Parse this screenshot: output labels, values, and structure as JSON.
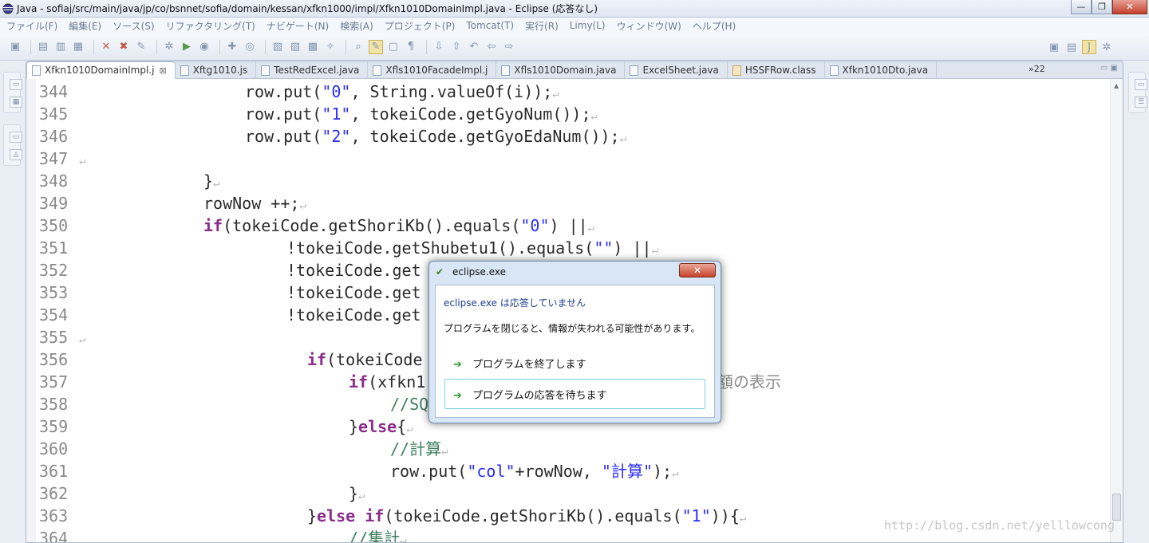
{
  "window": {
    "title": "Java - sofiaj/src/main/java/jp/co/bsnnet/sofia/domain/kessan/xfkn1000/impl/Xfkn1010DomainImpl.java - Eclipse (応答なし)",
    "buttons": {
      "minimize": "—",
      "maximize": "❐",
      "close": "✕"
    }
  },
  "menu": [
    "ファイル(F)",
    "編集(E)",
    "ソース(S)",
    "リファクタリング(T)",
    "ナビゲート(N)",
    "検索(A)",
    "プロジェクト(P)",
    "Tomcat(T)",
    "実行(R)",
    "Limy(L)",
    "ウィンドウ(W)",
    "ヘルプ(H)"
  ],
  "tabs": [
    {
      "label": "Xfkn1010DomainImpl.j",
      "active": true,
      "close": "⊠"
    },
    {
      "label": "Xftg1010.js"
    },
    {
      "label": "TestRedExcel.java"
    },
    {
      "label": "Xfls1010FacadeImpl.j"
    },
    {
      "label": "Xfls1010Domain.java"
    },
    {
      "label": "ExcelSheet.java"
    },
    {
      "label": "HSSFRow.class"
    },
    {
      "label": "Xfkn1010Dto.java"
    }
  ],
  "tab_overflow": "»22",
  "line_numbers": [
    "344",
    "345",
    "346",
    "347",
    "348",
    "349",
    "350",
    "351",
    "352",
    "353",
    "354",
    "355",
    "356",
    "357",
    "358",
    "359",
    "360",
    "361",
    "362",
    "363",
    "364"
  ],
  "code": {
    "l344_a": "row.put(",
    "l344_s": "\"0\"",
    "l344_b": ", String.valueOf(i));",
    "l345_a": "row.put(",
    "l345_s": "\"1\"",
    "l345_b": ", tokeiCode.getGyoNum());",
    "l346_a": "row.put(",
    "l346_s": "\"2\"",
    "l346_b": ", tokeiCode.getGyoEdaNum());",
    "l348": "}",
    "l349": "rowNow ++;",
    "l350_kw": "if",
    "l350_a": "(tokeiCode.getShoriKb().equals(",
    "l350_s": "\"0\"",
    "l350_b": ") ||",
    "l351_a": "!tokeiCode.getShubetu1().equals(",
    "l351_s": "\"\"",
    "l351_b": ") ||",
    "l352": "!tokeiCode.get",
    "l353": "!tokeiCode.get",
    "l354": "!tokeiCode.get",
    "l356_kw": "if",
    "l356_a": "(tokeiCode",
    "l357_kw": "if",
    "l357_a": "(xfkn1",
    "l357_tail": "額の表示",
    "l358_c": "//SQ",
    "l359_a": "}",
    "l359_kw": "else",
    "l359_b": "{",
    "l360_c": "//計算",
    "l361_a": "row.put(",
    "l361_s1": "\"col\"",
    "l361_b": "+rowNow, ",
    "l361_s2": "\"計算\"",
    "l361_c": ");",
    "l362": "}",
    "l363_a": "}",
    "l363_kw1": "else",
    "l363_kw2": "if",
    "l363_b": "(tokeiCode.getShoriKb().equals(",
    "l363_s": "\"1\"",
    "l363_c": ")){",
    "l364_c": "//集計",
    "eol": "↵"
  },
  "watermark": "http://blog.csdn.net/yelllowcong",
  "dialog": {
    "title": "eclipse.exe",
    "close": "✕",
    "heading": "eclipse.exe は応答していません",
    "message": "プログラムを閉じると、情報が失われる可能性があります。",
    "options": [
      {
        "label": "プログラムを終了します"
      },
      {
        "label": "プログラムの応答を待ちます"
      }
    ]
  }
}
